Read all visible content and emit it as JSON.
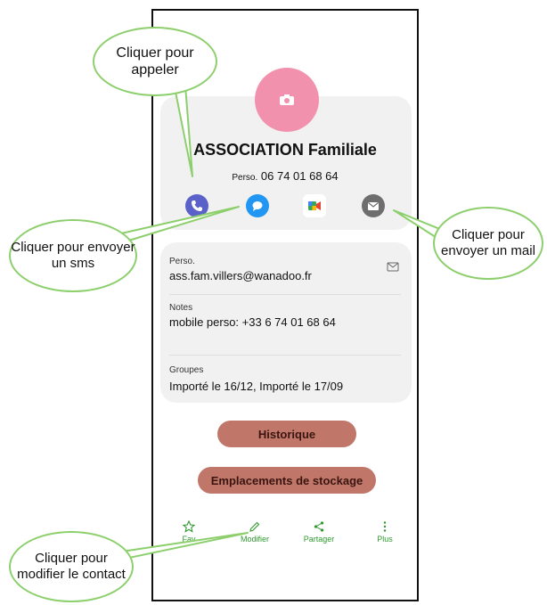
{
  "contact": {
    "name": "ASSOCIATION Familiale",
    "phone_label": "Perso.",
    "phone_number": "06 74 01 68 64"
  },
  "details": {
    "email_label": "Perso.",
    "email_value": "ass.fam.villers@wanadoo.fr",
    "notes_label": "Notes",
    "notes_value": "mobile perso: +33 6 74 01 68 64",
    "groups_label": "Groupes",
    "groups_value": "Importé le 16/12, Importé le 17/09"
  },
  "buttons": {
    "history": "Historique",
    "storage": "Emplacements de stockage"
  },
  "bottom_nav": {
    "favorites": "Fav",
    "edit": "Modifier",
    "share": "Partager",
    "more": "Plus"
  },
  "callouts": {
    "call": "Cliquer pour appeler",
    "sms": "Cliquer pour envoyer un sms",
    "mail": "Cliquer pour envoyer un mail",
    "edit": "Cliquer pour modifier le contact"
  },
  "icons": {
    "call": "phone-icon",
    "sms": "message-icon",
    "video": "video-icon",
    "mail": "mail-icon",
    "favorites": "star-icon",
    "edit": "pencil-icon",
    "share": "share-icon",
    "more": "more-icon"
  },
  "colors": {
    "avatar": "#f291ae",
    "call": "#5a61c8",
    "sms": "#2196f3",
    "mail": "#6e6e6e",
    "button": "#c0776a",
    "nav": "#2e9a2e",
    "callout_border": "#8ccf6c"
  }
}
